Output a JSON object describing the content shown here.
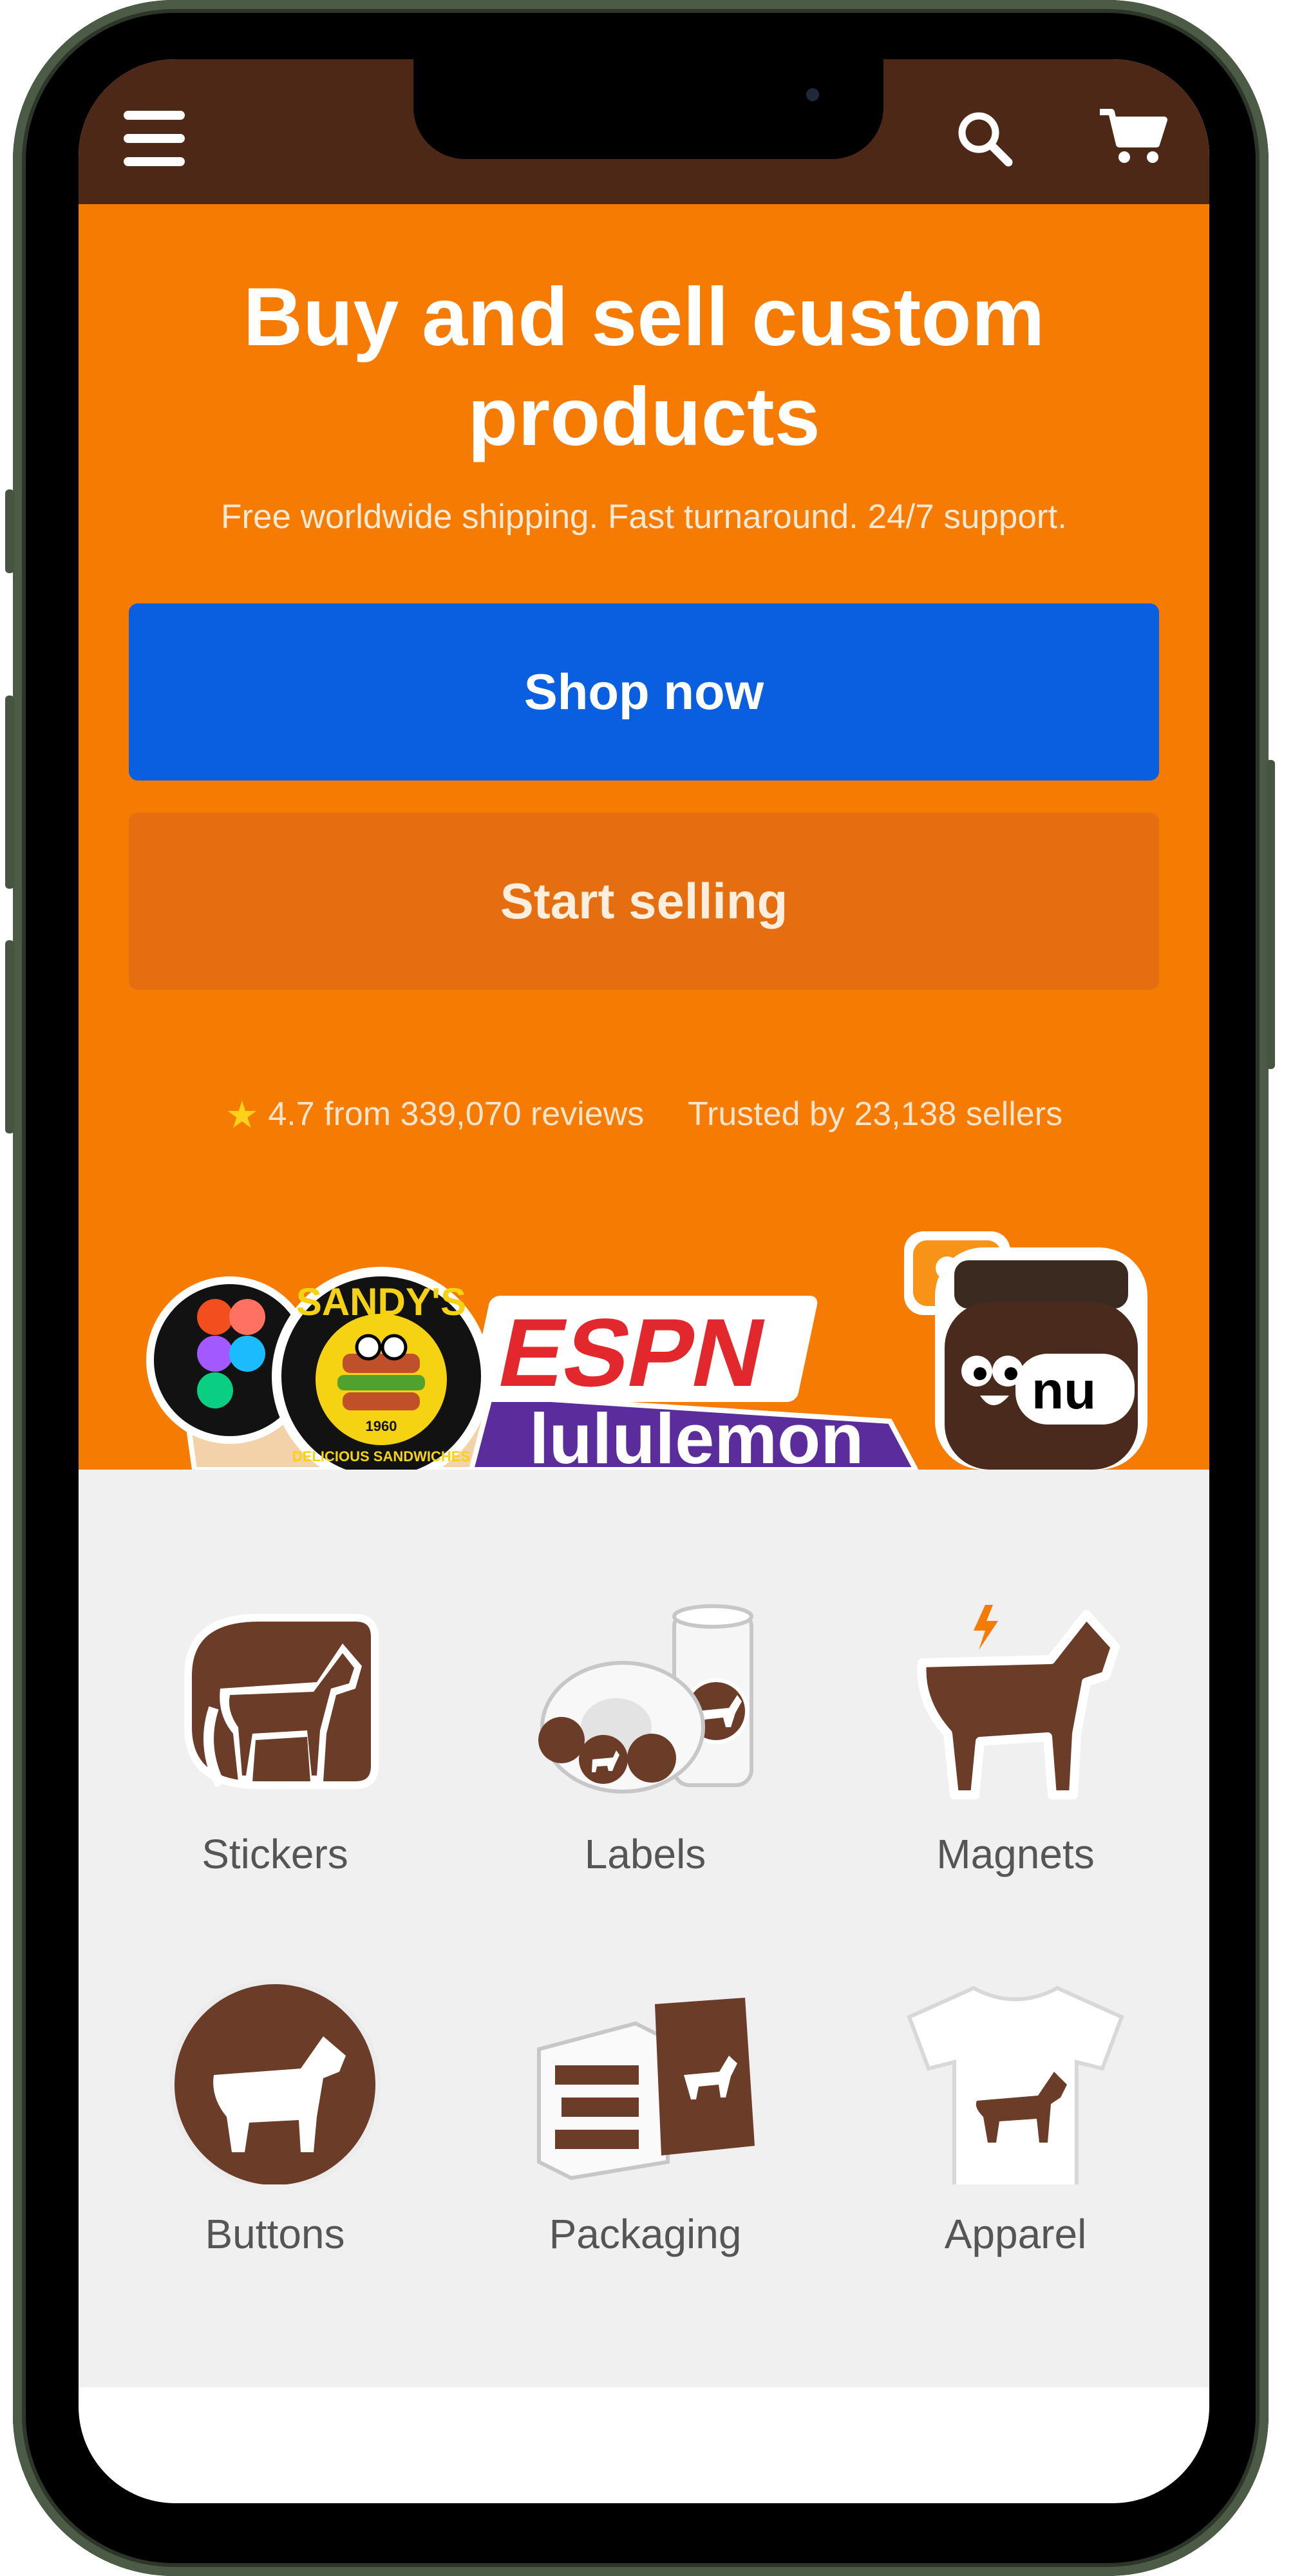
{
  "hero": {
    "title_line1": "Buy and sell custom",
    "title_line2": "products",
    "subtitle": "Free worldwide shipping. Fast turnaround. 24/7 support.",
    "shop_button": "Shop now",
    "sell_button": "Start selling",
    "rating_text": "4.7 from 339,070 reviews",
    "trusted_text": "Trusted by 23,138 sellers"
  },
  "sticker_brands": {
    "sandy": "SANDY'S",
    "sandy_tag": "DELICIOUS SANDWICHES",
    "sandy_year": "1960",
    "espn": "ESPN",
    "lululemon": "lululemon",
    "nutella": "nu"
  },
  "categories": [
    {
      "label": "Stickers",
      "icon": "stickers-icon"
    },
    {
      "label": "Labels",
      "icon": "labels-icon"
    },
    {
      "label": "Magnets",
      "icon": "magnets-icon"
    },
    {
      "label": "Buttons",
      "icon": "buttons-icon"
    },
    {
      "label": "Packaging",
      "icon": "packaging-icon"
    },
    {
      "label": "Apparel",
      "icon": "apparel-icon"
    }
  ],
  "colors": {
    "header_brown": "#4e2817",
    "hero_orange": "#f57b03",
    "shop_blue": "#0a5fe0",
    "sell_orange": "#e46e10",
    "horse_brown": "#6b3c28",
    "category_bg": "#f0f0f0"
  }
}
